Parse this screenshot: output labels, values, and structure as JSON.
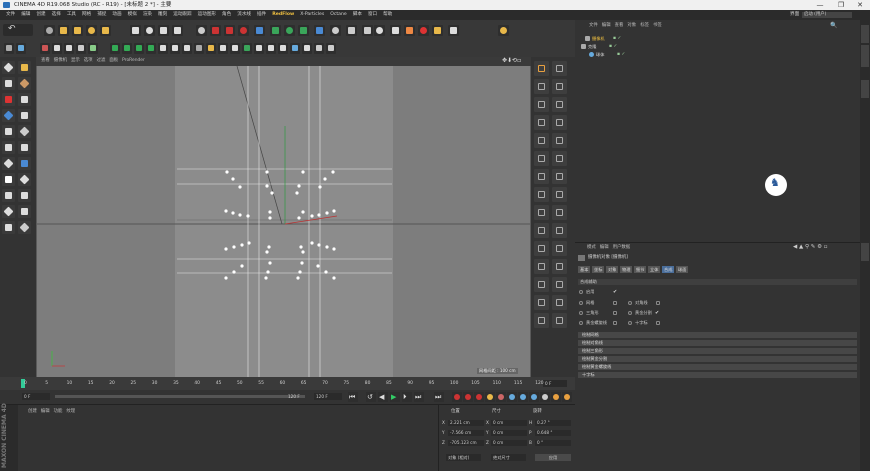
{
  "window": {
    "title": "CINEMA 4D R19.068 Studio (RC - R19) - [未标题 2 *] - 主要",
    "controls": [
      "—",
      "❐",
      "✕"
    ]
  },
  "menubar": {
    "items": [
      "文件",
      "编辑",
      "创建",
      "选择",
      "工具",
      "网格",
      "捕捉",
      "动画",
      "模拟",
      "渲染",
      "雕刻",
      "运动跟踪",
      "运动图形",
      "角色",
      "流水线",
      "插件",
      "RedFlow",
      "X-Particles",
      "Octane",
      "脚本",
      "窗口",
      "帮助"
    ],
    "active_index": 16,
    "layout_label": "界面",
    "layout_value": "启动 (用户)"
  },
  "viewport": {
    "menu": [
      "查看",
      "摄像机",
      "显示",
      "选项",
      "过滤",
      "面板",
      "ProRender"
    ],
    "name_badge": "透视视图",
    "grid_spacing": "网格间距 : 100 cm"
  },
  "object_manager": {
    "menu": [
      "文件",
      "编辑",
      "查看",
      "对象",
      "标签",
      "书签"
    ],
    "objects": [
      {
        "name": "摄像机",
        "selected": true
      },
      {
        "name": "克隆",
        "selected": false
      },
      {
        "name": "球体",
        "selected": false
      }
    ]
  },
  "attribute_manager": {
    "menu": [
      "模式",
      "编辑",
      "用户数据"
    ],
    "title": "摄像机对象 [摄像机]",
    "tabs": [
      "基本",
      "坐标",
      "对象",
      "物理",
      "细节",
      "立体",
      "合成",
      "球面"
    ],
    "active_tab": 6,
    "section_title": "合成辅助",
    "enable": {
      "label": "启用",
      "checked": true
    },
    "left_options": [
      {
        "label": "网格",
        "checked": false
      },
      {
        "label": "三角形",
        "checked": false
      },
      {
        "label": "黄金螺旋线",
        "checked": false
      }
    ],
    "right_options": [
      {
        "label": "对角线",
        "checked": false
      },
      {
        "label": "黄金分割",
        "checked": true
      },
      {
        "label": "十字标",
        "checked": false
      }
    ],
    "sections": [
      "绘制网格",
      "绘制对角线",
      "绘制三角形",
      "绘制黄金分割",
      "绘制黄金螺旋线",
      "十字标"
    ]
  },
  "timeline": {
    "ticks": [
      "0",
      "5",
      "10",
      "15",
      "20",
      "25",
      "30",
      "35",
      "40",
      "45",
      "50",
      "55",
      "60",
      "65",
      "70",
      "75",
      "80",
      "85",
      "90",
      "95",
      "100",
      "105",
      "110",
      "115",
      "120"
    ],
    "frame_display": "0 F",
    "start_frame": "0 F",
    "end_frame": "120 F",
    "max_frame": "120 F"
  },
  "material_manager": {
    "menu": [
      "创建",
      "编辑",
      "功能",
      "纹理"
    ]
  },
  "coordinates": {
    "headers": [
      "位置",
      "尺寸",
      "旋转"
    ],
    "rows": [
      {
        "axis": "X",
        "pos": "2.221 cm",
        "size_axis": "X",
        "size": "0 cm",
        "rot_axis": "H",
        "rot": "0.27 °"
      },
      {
        "axis": "Y",
        "pos": "-7.566 cm",
        "size_axis": "Y",
        "size": "0 cm",
        "rot_axis": "P",
        "rot": "0.648 °"
      },
      {
        "axis": "Z",
        "pos": "-705.123 cm",
        "size_axis": "Z",
        "size": "0 cm",
        "rot_axis": "B",
        "rot": "0 °"
      }
    ],
    "mode_select": "对象 (相对)",
    "size_select": "绝对尺寸",
    "apply_label": "应用"
  },
  "brand": {
    "logo_text": "MAXON CINEMA 4D"
  },
  "colors": {
    "accent": "#f0c040",
    "selected": "#4a6e9b",
    "viewport_bg": "#8a8a8a",
    "panel_bg": "#333333"
  }
}
